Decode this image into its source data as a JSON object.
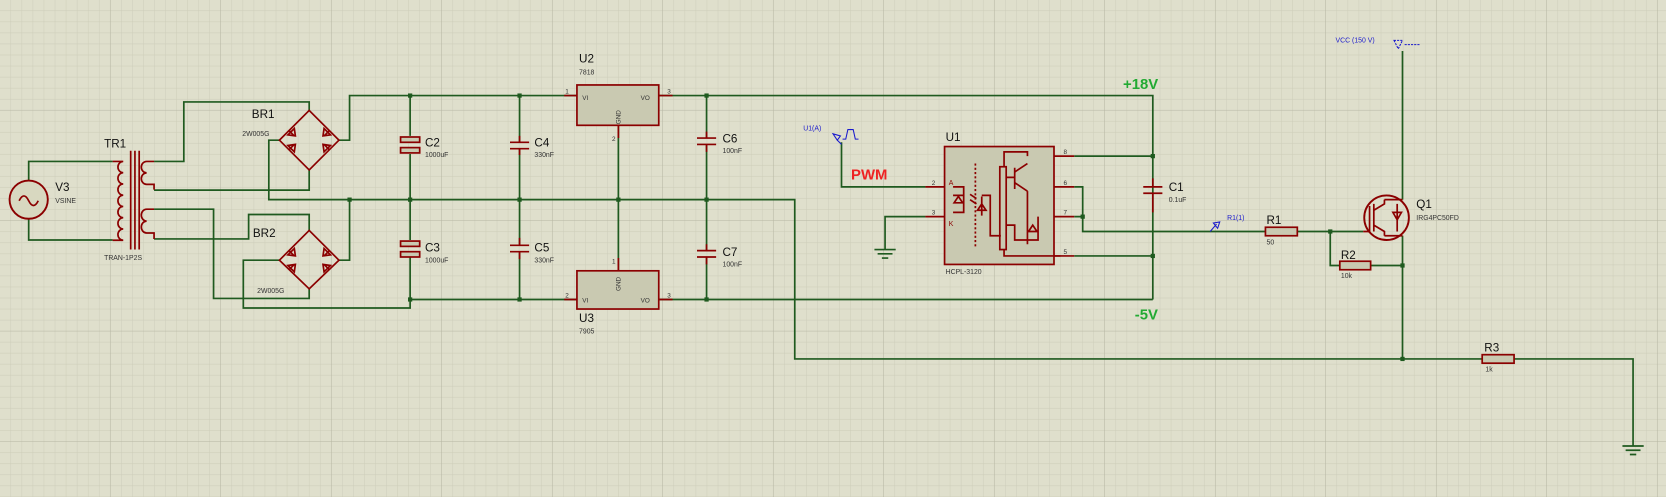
{
  "colors": {
    "background": "#dfdfcc",
    "wire": "#1f5a1f",
    "component": "#8b0000",
    "rail_label": "#22aa33",
    "pwm_label": "#ee2222",
    "probe": "#1a1acc"
  },
  "components": {
    "V3": {
      "ref": "V3",
      "value": "VSINE"
    },
    "TR1": {
      "ref": "TR1",
      "value": "TRAN-1P2S"
    },
    "BR1": {
      "ref": "BR1",
      "value": "2W005G"
    },
    "BR2": {
      "ref": "BR2",
      "value": "2W005G"
    },
    "C2": {
      "ref": "C2",
      "value": "1000uF"
    },
    "C3": {
      "ref": "C3",
      "value": "1000uF"
    },
    "C4": {
      "ref": "C4",
      "value": "330nF"
    },
    "C5": {
      "ref": "C5",
      "value": "330nF"
    },
    "C6": {
      "ref": "C6",
      "value": "100nF"
    },
    "C7": {
      "ref": "C7",
      "value": "100nF"
    },
    "C1": {
      "ref": "C1",
      "value": "0.1uF"
    },
    "U2": {
      "ref": "U2",
      "value": "7818",
      "vi": "VI",
      "vo": "VO",
      "gnd": "GND",
      "pin_in": "1",
      "pin_gnd": "2",
      "pin_out": "3"
    },
    "U3": {
      "ref": "U3",
      "value": "7905",
      "vi": "VI",
      "vo": "VO",
      "gnd": "GND",
      "pin_in": "2",
      "pin_gnd": "1",
      "pin_out": "3"
    },
    "U1": {
      "ref": "U1",
      "value": "HCPL-3120",
      "pin2": "2",
      "pin3": "3",
      "pin8": "8",
      "pin6": "6",
      "pin7": "7",
      "pin5": "5",
      "anode": "A",
      "cathode": "K"
    },
    "R1": {
      "ref": "R1",
      "value": "50"
    },
    "R2": {
      "ref": "R2",
      "value": "10k"
    },
    "R3": {
      "ref": "R3",
      "value": "1k"
    },
    "Q1": {
      "ref": "Q1",
      "value": "IRG4PC50FD"
    }
  },
  "net_labels": {
    "plus18": "+18V",
    "minus5": "-5V",
    "pwm": "PWM"
  },
  "probes": {
    "u1a": "U1(A)",
    "r1": "R1(1)"
  },
  "terminals": {
    "vcc": "VCC (150 V)"
  }
}
